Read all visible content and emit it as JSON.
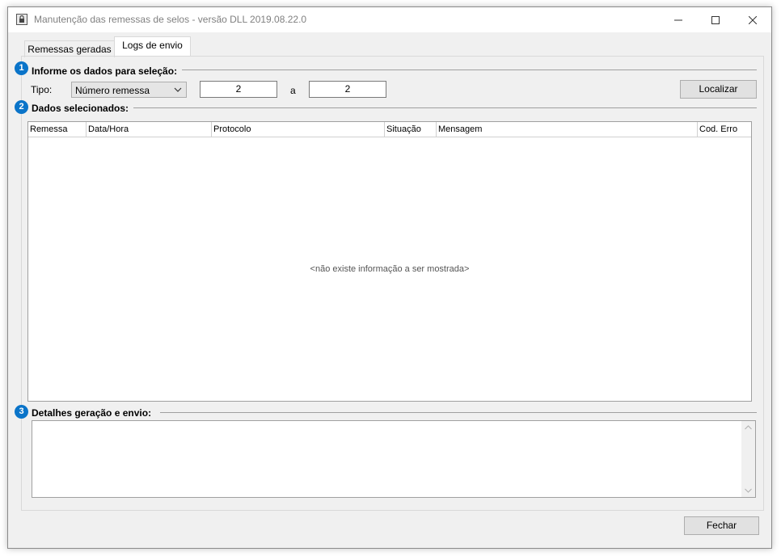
{
  "window": {
    "title": "Manutenção das remessas de selos - versão DLL 2019.08.22.0",
    "controls": {
      "minimize": "minimize",
      "maximize": "maximize",
      "close": "close"
    }
  },
  "tabs": [
    {
      "label": "Remessas geradas",
      "active": false
    },
    {
      "label": "Logs de envio",
      "active": true
    }
  ],
  "section1": {
    "number": "1",
    "title": "Informe os dados para seleção:",
    "tipo_label": "Tipo:",
    "tipo_value": "Número remessa",
    "from_value": "2",
    "separator": "a",
    "to_value": "2",
    "search_button": "Localizar"
  },
  "section2": {
    "number": "2",
    "title": "Dados selecionados:",
    "columns": [
      "Remessa",
      "Data/Hora",
      "Protocolo",
      "Situação",
      "Mensagem",
      "Cod. Erro"
    ],
    "empty_message": "<não existe informação a ser mostrada>"
  },
  "section3": {
    "number": "3",
    "title": "Detalhes geração e envio:",
    "details_value": ""
  },
  "footer": {
    "close_button": "Fechar"
  },
  "colors": {
    "badge": "#0a74c9",
    "window_bg": "#f0f0f0"
  }
}
